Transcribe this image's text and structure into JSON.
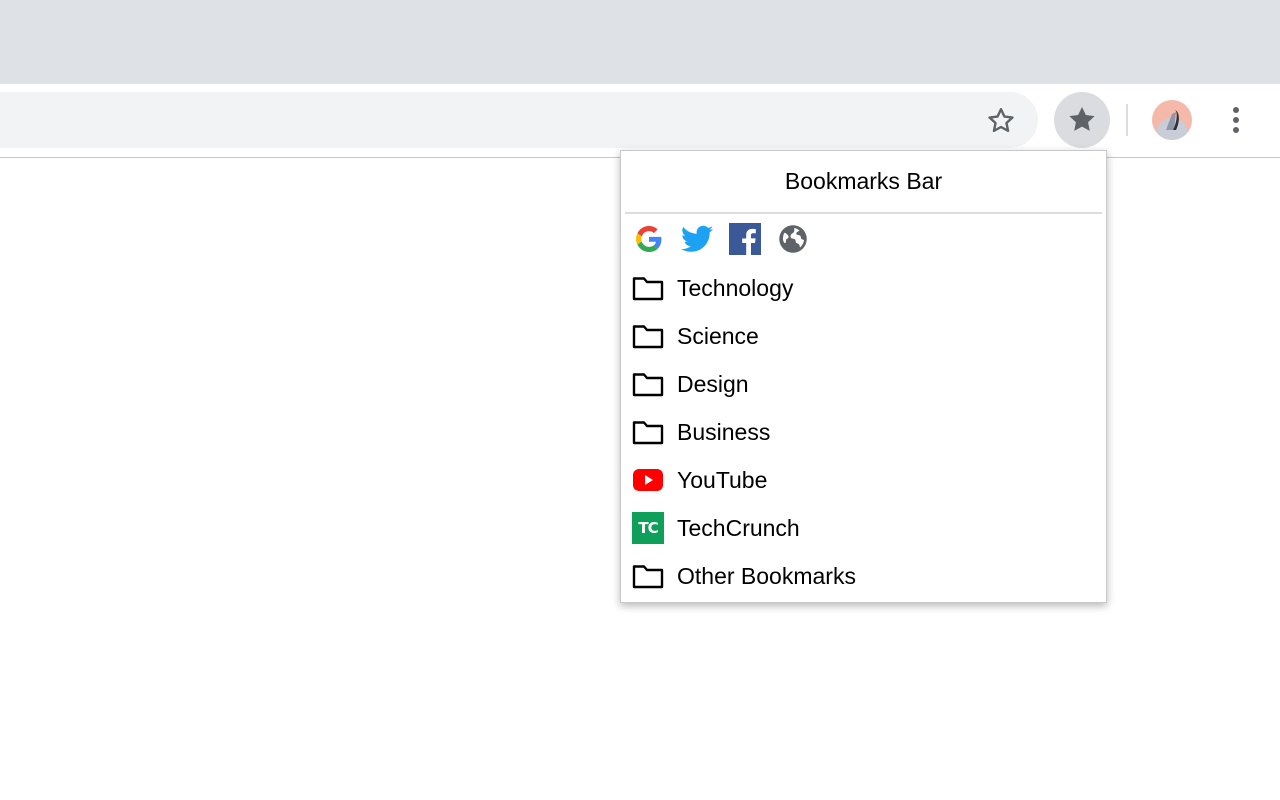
{
  "browser": {
    "omnibox": {
      "star_icon": "star-outline-icon"
    },
    "toolbar": {
      "bookmarks_button_icon": "star-filled-icon",
      "profile_icon": "avatar",
      "menu_icon": "more-vert-icon"
    },
    "colors": {
      "tabstrip": "#dee1e6",
      "omnibox": "#f1f3f4",
      "icon_gray": "#5f6368"
    }
  },
  "popup": {
    "title": "Bookmarks Bar",
    "quick_links": [
      {
        "icon": "google-icon"
      },
      {
        "icon": "twitter-icon"
      },
      {
        "icon": "facebook-icon"
      },
      {
        "icon": "globe-icon"
      }
    ],
    "items": [
      {
        "label": "Technology",
        "icon": "folder-icon"
      },
      {
        "label": "Science",
        "icon": "folder-icon"
      },
      {
        "label": "Design",
        "icon": "folder-icon"
      },
      {
        "label": "Business",
        "icon": "folder-icon"
      },
      {
        "label": "YouTube",
        "icon": "youtube-icon"
      },
      {
        "label": "TechCrunch",
        "icon": "techcrunch-icon",
        "logo_text": "TC"
      },
      {
        "label": "Other Bookmarks",
        "icon": "folder-icon"
      }
    ]
  }
}
